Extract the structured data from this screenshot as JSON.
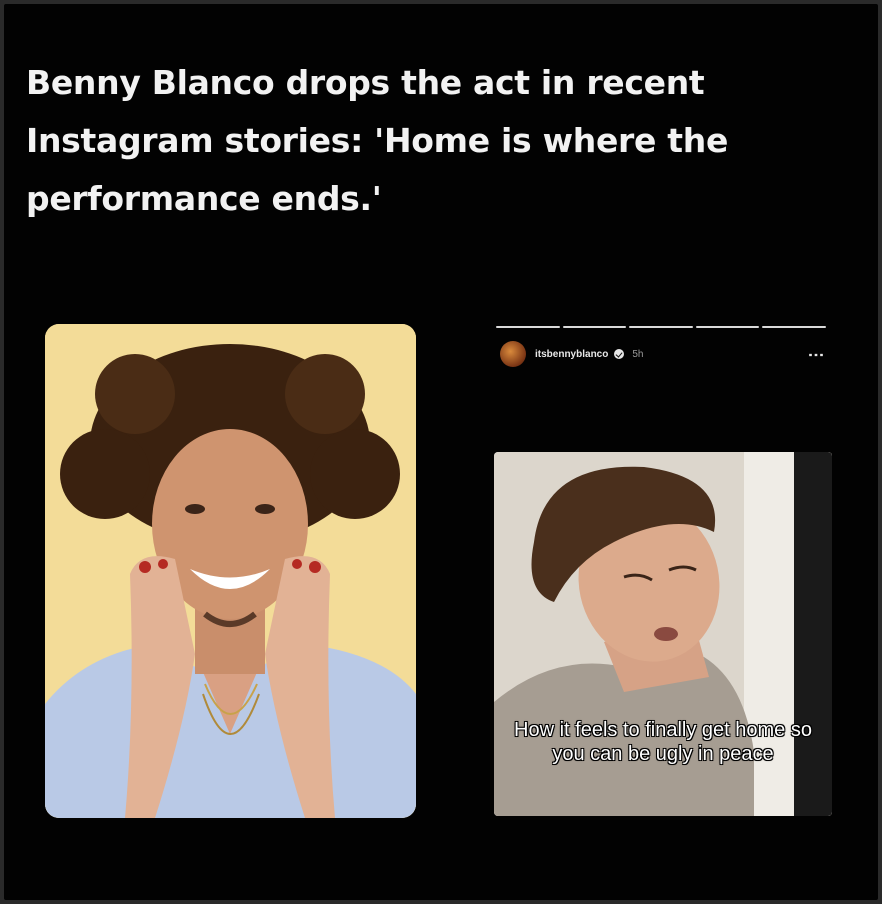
{
  "headline": "Benny Blanco drops the act in recent Instagram stories: 'Home is where the performance ends.'",
  "left_photo": {
    "description_icon": "portrait-photo",
    "background_color": "#f3dc98"
  },
  "story": {
    "username": "itsbennyblanco",
    "time": "5h",
    "more_icon": "⋮",
    "progress_segments": [
      {
        "state": "done"
      },
      {
        "state": "done"
      },
      {
        "state": "done"
      },
      {
        "state": "done"
      },
      {
        "state": "current"
      }
    ],
    "caption": "How it feels to finally get home so you can be ugly in peace"
  },
  "colors": {
    "background": "#020202",
    "headline": "#f2f2f2"
  }
}
